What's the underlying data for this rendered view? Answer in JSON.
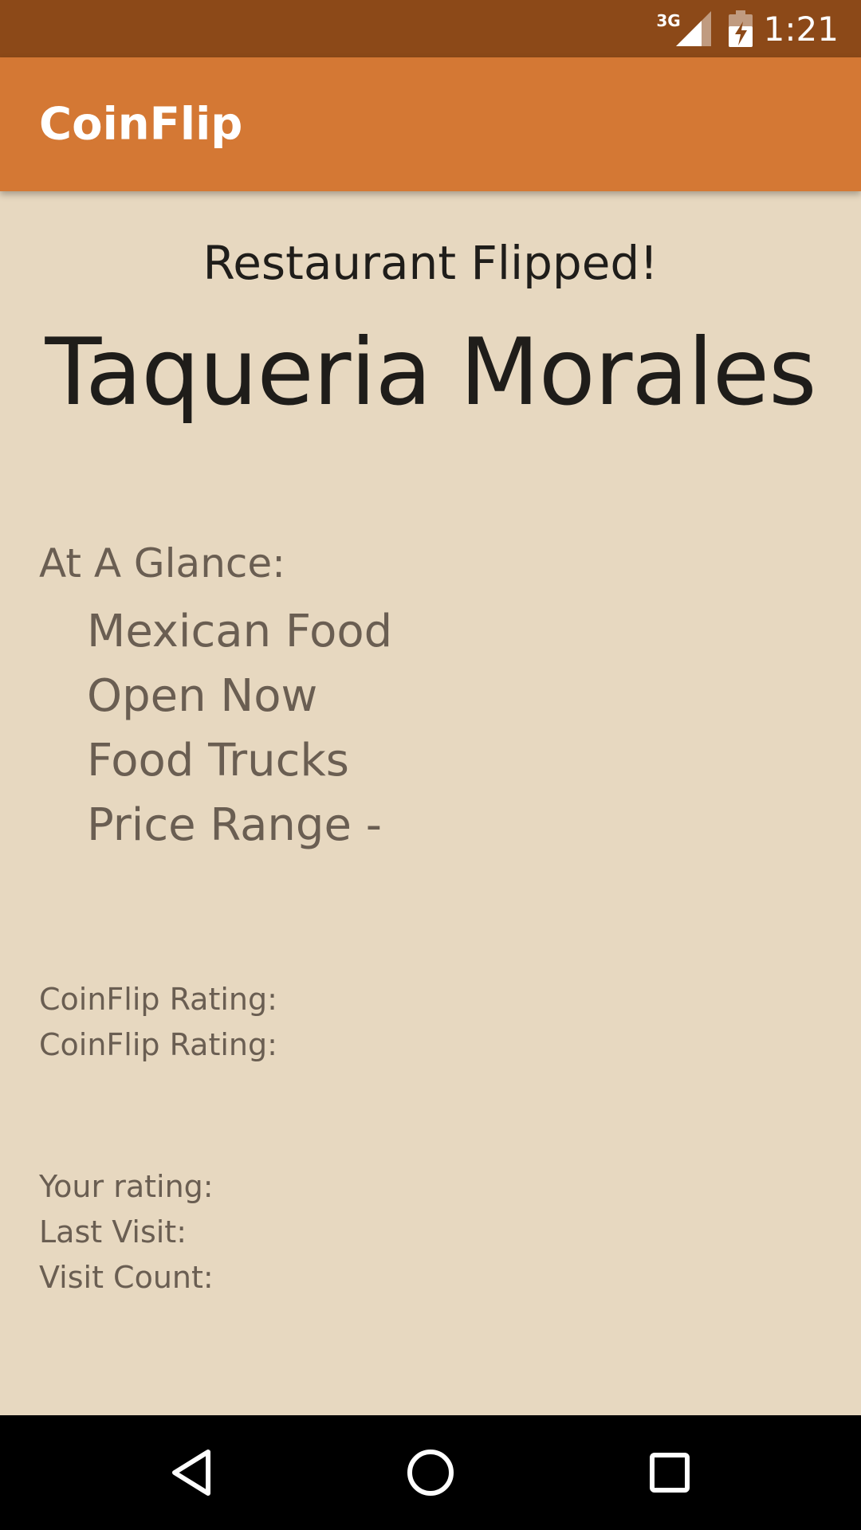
{
  "status_bar": {
    "network": "3G",
    "time": "1:21",
    "icons": [
      "signal-icon",
      "battery-charging-icon"
    ]
  },
  "app_bar": {
    "title": "CoinFlip"
  },
  "main": {
    "heading": "Restaurant Flipped!",
    "restaurant_name": "Taqueria Morales",
    "glance_label": "At A Glance:",
    "glance_items": [
      "Mexican Food",
      "Open Now",
      "Food Trucks",
      "Price Range -"
    ],
    "coinflip_rating_1": "CoinFlip Rating:",
    "coinflip_rating_2": "CoinFlip Rating:",
    "your_rating": "Your rating:",
    "last_visit": "Last Visit:",
    "visit_count": "Visit Count:"
  },
  "nav_bar": {
    "icons": [
      "back-icon",
      "home-icon",
      "recents-icon"
    ]
  },
  "colors": {
    "status_bar": "#8c4918",
    "app_bar": "#d47834",
    "background": "#e7d8c0",
    "primary_text": "#1f1d1a",
    "secondary_text": "#6a5e52"
  }
}
